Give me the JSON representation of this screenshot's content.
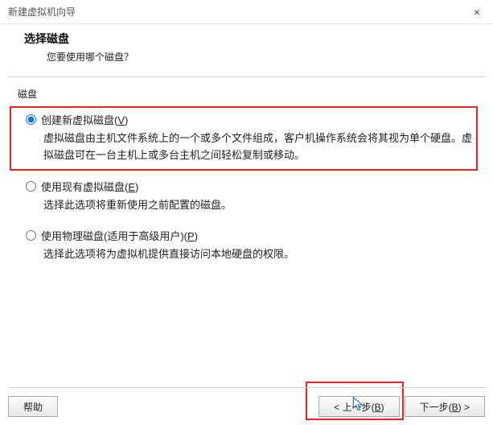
{
  "window": {
    "title": "新建虚拟机向导",
    "close": "×"
  },
  "header": {
    "title": "选择磁盘",
    "subtitle": "您要使用哪个磁盘？"
  },
  "section": {
    "label": "磁盘"
  },
  "options": [
    {
      "label_pre": "创建新虚拟磁盘(",
      "label_key": "V",
      "label_post": ")",
      "desc": "虚拟磁盘由主机文件系统上的一个或多个文件组成，客户机操作系统会将其视为单个硬盘。虚拟磁盘可在一台主机上或多台主机之间轻松复制或移动。",
      "checked": true
    },
    {
      "label_pre": "使用现有虚拟磁盘(",
      "label_key": "E",
      "label_post": ")",
      "desc": "选择此选项将重新使用之前配置的磁盘。",
      "checked": false
    },
    {
      "label_pre": "使用物理磁盘(适用于高级用户)(",
      "label_key": "P",
      "label_post": ")",
      "desc": "选择此选项将为虚拟机提供直接访问本地硬盘的权限。",
      "checked": false
    }
  ],
  "buttons": {
    "help": "帮助",
    "back_pre": "< 上一步(",
    "back_key": "B",
    "back_post": ")",
    "next_pre": "下一步(",
    "next_key": "B",
    "next_post": ") >"
  }
}
